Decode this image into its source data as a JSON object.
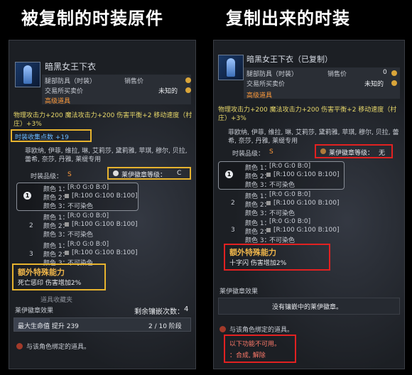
{
  "headings": {
    "left": "被复制的时装原件",
    "right": "复制出来的时装"
  },
  "left": {
    "item_name": "暗黑女王下衣",
    "type": "腿部防具（时装）",
    "sale_label": "销售价",
    "trade_label": "交易所买卖价",
    "trade_value": "未知的",
    "grade": "高级道具",
    "stats": "物理攻击力+200 魔法攻击力+200 伤害平衡+2 移动速度（村庄）+3%",
    "collection": "时装收集点数 +19",
    "classes": "菲欧纳, 伊菲, 维拉, 琳, 艾莉莎, 黛莉雅, 苹琪, 穆尔, 贝拉, 蕾希, 奈莎, 丹雅, 莱缇专用",
    "quality_label": "时装品级：",
    "quality_value": "S",
    "badge_label": "莱伊徽章等级：",
    "badge_value": "C",
    "dye_sets": [
      {
        "num": "1",
        "rows": [
          [
            "颜色 1：",
            "[R:0 G:0 B:0]"
          ],
          [
            "颜色 2：",
            "[R:100 G:100 B:100]"
          ],
          [
            "颜色 3：",
            "不可染色"
          ]
        ]
      },
      {
        "num": "2",
        "rows": [
          [
            "颜色 1：",
            "[R:0 G:0 B:0]"
          ],
          [
            "颜色 2：",
            "[R:100 G:100 B:100]"
          ],
          [
            "颜色 3：",
            "不可染色"
          ]
        ]
      },
      {
        "num": "3",
        "rows": [
          [
            "颜色 1：",
            "[R:0 G:0 B:0]"
          ],
          [
            "颜色 2：",
            "[R:100 G:100 B:100]"
          ],
          [
            "颜色 3：",
            "不可染色"
          ]
        ]
      }
    ],
    "special_title": "额外特殊能力",
    "special_effect": "死亡惩印 伤害增加2%",
    "collection_hint": "道具收藏夹",
    "badge_effect_title": "莱伊徽章效果",
    "remaining_label": "剩余镶嵌次数：",
    "remaining_value": "4",
    "bar_label": "最大生命值 提升 239",
    "bar_stage": "2 / 10 阶段",
    "bar_progress": 0.2,
    "bound_text": "与该角色绑定的道具。"
  },
  "right": {
    "item_name": "暗黑女王下衣（已复制）",
    "type": "腿部防具（时装）",
    "sale_label": "销售价",
    "sale_value": "0",
    "trade_label": "交易所买卖价",
    "trade_value": "未知的",
    "grade": "高级道具",
    "stats": "物理攻击力+200 魔法攻击力+200 伤害平衡+2 移动速度（村庄）+3%",
    "classes": "菲欧纳, 伊菲, 维拉, 琳, 艾莉莎, 黛莉雅, 苹琪, 穆尔, 贝拉, 蕾希, 奈莎, 丹雅, 莱缇专用",
    "quality_label": "时装品级：",
    "quality_value": "S",
    "badge_label": "莱伊徽章等级：",
    "badge_value": "无",
    "dye_sets": [
      {
        "num": "1",
        "rows": [
          [
            "颜色 1：",
            "[R:0 G:0 B:0]"
          ],
          [
            "颜色 2：",
            "[R:100 G:100 B:100]"
          ],
          [
            "颜色 3：",
            "不可染色"
          ]
        ]
      },
      {
        "num": "2",
        "rows": [
          [
            "颜色 1：",
            "[R:0 G:0 B:0]"
          ],
          [
            "颜色 2：",
            "[R:100 G:100 B:100]"
          ],
          [
            "颜色 3：",
            "不可染色"
          ]
        ]
      },
      {
        "num": "3",
        "rows": [
          [
            "颜色 1：",
            "[R:0 G:0 B:0]"
          ],
          [
            "颜色 2：",
            "[R:100 G:100 B:100]"
          ],
          [
            "颜色 3：",
            "不可染色"
          ]
        ]
      }
    ],
    "special_title": "额外特殊能力",
    "special_effect": "十字闪 伤害增加2%",
    "badge_effect_title": "莱伊徽章效果",
    "no_badge_text": "没有镶嵌中的莱伊徽章。",
    "bound_text": "与该角色绑定的道具。",
    "disabled_title": "以下功能不可用。",
    "disabled_items": "：合成, 解除"
  }
}
